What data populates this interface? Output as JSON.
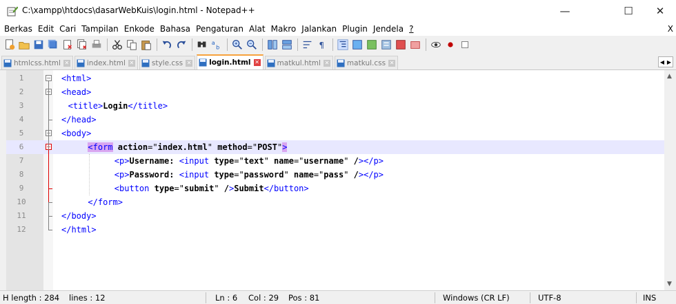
{
  "window": {
    "title": "C:\\xampp\\htdocs\\dasarWebKuis\\login.html - Notepad++",
    "minimize": "—",
    "maximize": "☐",
    "close": "✕"
  },
  "menu": [
    "Berkas",
    "Edit",
    "Cari",
    "Tampilan",
    "Enkode",
    "Bahasa",
    "Pengaturan",
    "Alat",
    "Makro",
    "Jalankan",
    "Plugin",
    "Jendela",
    "?"
  ],
  "menu_overflow": "X",
  "toolbar_icons": [
    "new-file-icon",
    "open-file-icon",
    "save-icon",
    "save-all-icon",
    "close-icon",
    "close-all-icon",
    "print-icon",
    "cut-icon",
    "copy-icon",
    "paste-icon",
    "undo-icon",
    "redo-icon",
    "find-icon",
    "replace-icon",
    "zoom-in-icon",
    "zoom-out-icon",
    "sync-vertical-icon",
    "sync-horizontal-icon",
    "word-wrap-icon",
    "show-all-characters-icon",
    "indent-guide-icon",
    "udl-icon",
    "document-map-icon",
    "function-list-icon",
    "folder-workspace-icon",
    "monitoring-icon",
    "record-macro-icon",
    "stop-macro-icon",
    "play-macro-icon"
  ],
  "tabs": [
    {
      "label": "htmlcss.html",
      "active": false
    },
    {
      "label": "index.html",
      "active": false
    },
    {
      "label": "style.css",
      "active": false
    },
    {
      "label": "login.html",
      "active": true
    },
    {
      "label": "matkul.html",
      "active": false
    },
    {
      "label": "matkul.css",
      "active": false
    }
  ],
  "lines": [
    {
      "num": "1",
      "text": "<html>"
    },
    {
      "num": "2",
      "text": "<head>"
    },
    {
      "num": "3",
      "text": "<title>Login</title>"
    },
    {
      "num": "4",
      "text": "</head>"
    },
    {
      "num": "5",
      "text": "<body>"
    },
    {
      "num": "6",
      "text": "<form action=\"index.html\" method=\"POST\">"
    },
    {
      "num": "7",
      "text": "<p>Username: <input type=\"text\" name=\"username\" /></p>"
    },
    {
      "num": "8",
      "text": "<p>Password: <input type=\"password\" name=\"pass\" /></p>"
    },
    {
      "num": "9",
      "text": "<button type=\"submit\" />Submit</button>"
    },
    {
      "num": "10",
      "text": "</form>"
    },
    {
      "num": "11",
      "text": "</body>"
    },
    {
      "num": "12",
      "text": "</html>"
    }
  ],
  "current_line": 6,
  "status": {
    "length": "H length : 284",
    "lines": "lines : 12",
    "ln": "Ln : 6",
    "col": "Col : 29",
    "pos": "Pos : 81",
    "eol": "Windows (CR LF)",
    "encoding": "UTF-8",
    "mode": "INS"
  },
  "colors": {
    "tag": "#0000ff",
    "attribute": "#ff0000",
    "value": "#8000ff",
    "current_line": "#e8e8ff",
    "tag_match": "#d9a6f0",
    "active_tab_accent": "#f7a23c"
  }
}
